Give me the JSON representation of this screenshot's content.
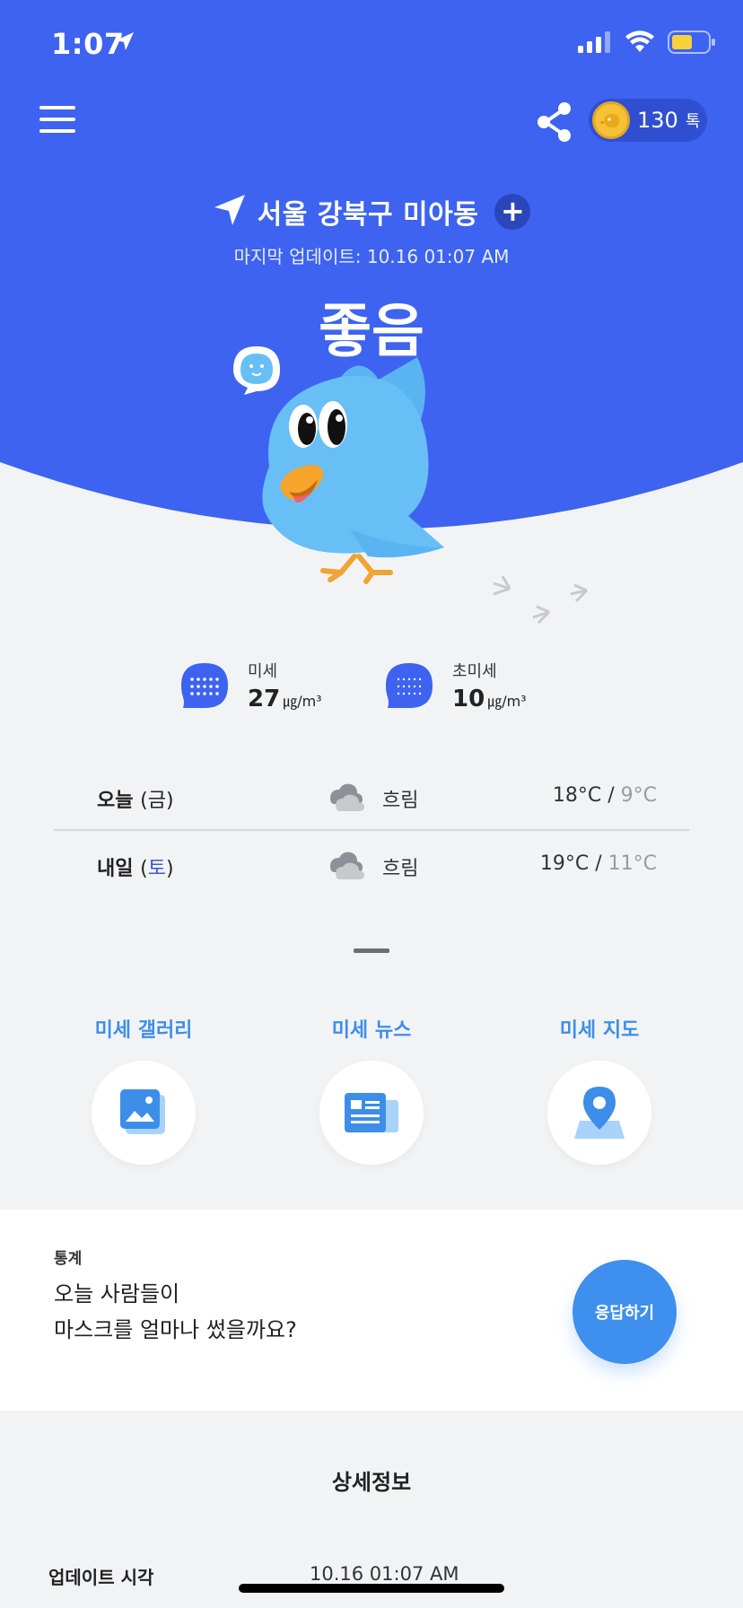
{
  "colors": {
    "primary_blue": "#3d63f0",
    "accent_blue": "#3d8ee8",
    "background": "#f2f3f5",
    "saturday_blue": "#3a5ad6"
  },
  "status_bar": {
    "time": "1:07",
    "icons": [
      "location-arrow-icon",
      "cellular-signal-icon",
      "wifi-icon",
      "battery-icon"
    ]
  },
  "header": {
    "menu_icon": "hamburger-menu-icon",
    "share_icon": "share-icon",
    "coin_icon": "bird-coin-icon",
    "coin_count": "130",
    "coin_unit": "톡"
  },
  "location": {
    "name": "서울 강북구 미아동",
    "add_label": "+",
    "update_text": "마지막 업데이트: 10.16 01:07 AM"
  },
  "air_quality": {
    "grade": "좋음",
    "fine_dust": {
      "label": "미세",
      "value": "27",
      "unit": "㎍/m³"
    },
    "ultra_fine_dust": {
      "label": "초미세",
      "value": "10",
      "unit": "㎍/m³"
    }
  },
  "forecast": [
    {
      "day": "오늘",
      "dow": "금",
      "condition": "흐림",
      "high": "18°C",
      "low": "9°C",
      "icon": "cloudy-icon"
    },
    {
      "day": "내일",
      "dow": "토",
      "condition": "흐림",
      "high": "19°C",
      "low": "11°C",
      "icon": "cloudy-icon"
    }
  ],
  "quick_links": [
    {
      "title": "미세 갤러리",
      "icon": "gallery-icon"
    },
    {
      "title": "미세 뉴스",
      "icon": "news-icon"
    },
    {
      "title": "미세 지도",
      "icon": "map-pin-icon"
    }
  ],
  "survey": {
    "tag": "통계",
    "question_line1": "오늘 사람들이",
    "question_line2": "마스크를 얼마나 썼을까요?",
    "answer_label": "응답하기"
  },
  "details": {
    "title": "상세정보",
    "rows": [
      {
        "label": "업데이트 시각",
        "value": "10.16 01:07 AM"
      }
    ]
  }
}
